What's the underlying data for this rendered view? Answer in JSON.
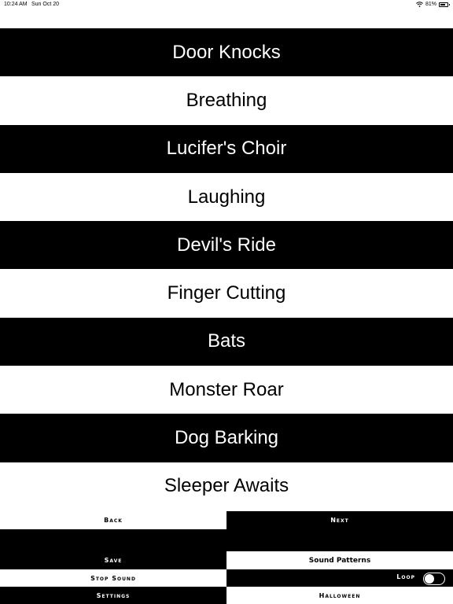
{
  "status_bar": {
    "time": "10:24 AM",
    "date": "Sun Oct 20",
    "battery": "81%",
    "battery_level": 0.81,
    "wifi_icon": "wifi-icon",
    "battery_icon": "battery-icon"
  },
  "sounds": [
    {
      "label": "Door Knocks"
    },
    {
      "label": "Breathing"
    },
    {
      "label": "Lucifer's Choir"
    },
    {
      "label": "Laughing"
    },
    {
      "label": "Devil's Ride"
    },
    {
      "label": "Finger Cutting"
    },
    {
      "label": "Bats"
    },
    {
      "label": "Monster Roar"
    },
    {
      "label": "Dog Barking"
    },
    {
      "label": "Sleeper Awaits"
    }
  ],
  "controls": {
    "back": "Back",
    "next": "Next",
    "save": "Save",
    "sound_patterns": "Sound Patterns",
    "stop_sound": "Stop Sound",
    "loop": "Loop",
    "loop_on": false,
    "settings": "Settings",
    "halloween": "Halloween"
  },
  "colors": {
    "dark": "#000000",
    "light": "#ffffff"
  }
}
